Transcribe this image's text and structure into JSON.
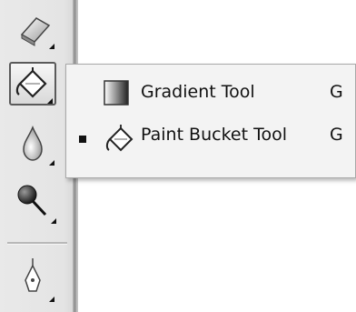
{
  "toolbar": {
    "tools": [
      {
        "icon": "eraser-icon",
        "active": false
      },
      {
        "icon": "paint-bucket-icon",
        "active": true
      },
      {
        "icon": "blur-drop-icon",
        "active": false
      },
      {
        "icon": "dodge-icon",
        "active": false
      },
      {
        "icon": "pen-icon",
        "active": false
      }
    ]
  },
  "flyout": {
    "items": [
      {
        "label": "Gradient Tool",
        "shortcut": "G",
        "icon": "gradient-icon",
        "selected": false
      },
      {
        "label": "Paint Bucket Tool",
        "shortcut": "G",
        "icon": "paint-bucket-icon",
        "selected": true
      }
    ]
  },
  "colors": {
    "toolbar_bg": "#e6e6e6",
    "menu_bg": "#f3f3f3",
    "text": "#111111"
  }
}
